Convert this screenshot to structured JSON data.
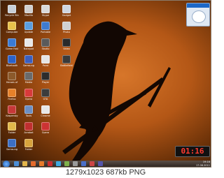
{
  "desktop": {
    "column1": [
      {
        "icon": "recycle-bin-icon",
        "label": "Recycle Bin",
        "color": "#c8d0d8"
      },
      {
        "icon": "folder-icon",
        "label": "Computer",
        "color": "#e7c24b"
      },
      {
        "icon": "app-icon",
        "label": "Game Fast",
        "color": "#3a7bd5"
      },
      {
        "icon": "app-icon",
        "label": "Bluetooth",
        "color": "#2b62c9"
      },
      {
        "icon": "app-icon",
        "label": "Heroes of",
        "color": "#8c5a2b"
      },
      {
        "icon": "app-icon",
        "label": "Firefox",
        "color": "#e6812a"
      },
      {
        "icon": "app-icon",
        "label": "Kaspersky",
        "color": "#c73838"
      },
      {
        "icon": "app-icon",
        "label": "Folder",
        "color": "#e2b94a"
      },
      {
        "icon": "app-icon",
        "label": "Samsung",
        "color": "#3c6fc4"
      }
    ],
    "column2": [
      {
        "icon": "app-icon",
        "label": "Mozilla",
        "color": "#d0d0d0"
      },
      {
        "icon": "app-icon",
        "label": "Update",
        "color": "#5a9ee0"
      },
      {
        "icon": "app-icon",
        "label": "Notepad",
        "color": "#e8e8e8"
      },
      {
        "icon": "app-icon",
        "label": "Samsung",
        "color": "#3b5fbf"
      },
      {
        "icon": "app-icon",
        "label": "Media",
        "color": "#6a6a6a"
      },
      {
        "icon": "app-icon",
        "label": "Opera",
        "color": "#d83a3a"
      },
      {
        "icon": "app-icon",
        "label": "Tools",
        "color": "#6c8fc4"
      },
      {
        "icon": "app-icon",
        "label": "Acrobat",
        "color": "#c02f2f"
      },
      {
        "icon": "app-icon",
        "label": "Folder",
        "color": "#d7a33c"
      }
    ],
    "column3": [
      {
        "icon": "app-icon",
        "label": "Skype",
        "color": "#d9d9d9"
      },
      {
        "icon": "app-icon",
        "label": "Portable",
        "color": "#3f7bd0"
      },
      {
        "icon": "app-icon",
        "label": "Studio",
        "color": "#5a5a5a"
      },
      {
        "icon": "app-icon",
        "label": "Paint",
        "color": "#e5e5e5"
      },
      {
        "icon": "app-icon",
        "label": "Player",
        "color": "#2c2c2c"
      },
      {
        "icon": "app-icon",
        "label": "GTA",
        "color": "#3c3c3c"
      },
      {
        "icon": "app-icon",
        "label": "Chrome",
        "color": "#e7e7e7"
      },
      {
        "icon": "app-icon",
        "label": "Opera",
        "color": "#cc3333"
      }
    ],
    "column4": [
      {
        "icon": "app-icon",
        "label": "Gadget",
        "color": "#cfd6e0"
      },
      {
        "icon": "app-icon",
        "label": "Photo",
        "color": "#d0d0d0"
      },
      {
        "icon": "app-icon",
        "label": "Video",
        "color": "#2a2a2a"
      },
      {
        "icon": "app-icon",
        "label": "Battlefield",
        "color": "#3a3a3a"
      }
    ]
  },
  "clock_widget": {
    "time": "01:16"
  },
  "taskbar": {
    "tray_time": "19:16",
    "tray_date": "17.08.2011",
    "items": [
      {
        "icon": "ie-icon",
        "color": "#4c8fd6"
      },
      {
        "icon": "explorer-icon",
        "color": "#e3b54a"
      },
      {
        "icon": "media-icon",
        "color": "#e56b2c"
      },
      {
        "icon": "firefox-icon",
        "color": "#e87a2a"
      },
      {
        "icon": "opera-icon",
        "color": "#cc2e2e"
      },
      {
        "icon": "skype-icon",
        "color": "#3fa9e0"
      },
      {
        "icon": "app-icon",
        "color": "#7fb04a"
      },
      {
        "icon": "app-icon",
        "color": "#9a9a9a"
      },
      {
        "icon": "app-icon",
        "color": "#4a6fc8"
      },
      {
        "icon": "app-icon",
        "color": "#c44"
      },
      {
        "icon": "app-icon",
        "color": "#55a"
      }
    ]
  },
  "caption": "1279x1023  687kb  PNG"
}
